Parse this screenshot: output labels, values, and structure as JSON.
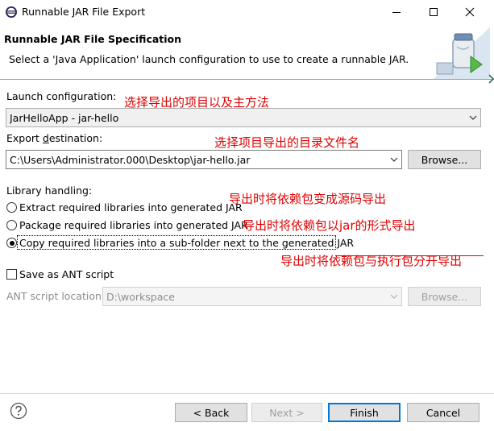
{
  "window": {
    "title": "Runnable JAR File Export",
    "minimize_icon": "minimize-icon",
    "maximize_icon": "maximize-icon",
    "close_icon": "close-icon"
  },
  "header": {
    "title": "Runnable JAR File Specification",
    "description": "Select a 'Java Application' launch configuration to use to create a runnable JAR.",
    "graphic_icon": "jar-export-wizard-icon"
  },
  "launch": {
    "label": "Launch configuration:",
    "value": "JarHelloApp - jar-hello"
  },
  "export": {
    "label": "Export destination:",
    "value": "C:\\Users\\Administrator.000\\Desktop\\jar-hello.jar",
    "browse_label": "Browse..."
  },
  "library": {
    "label": "Library handling:",
    "options": [
      {
        "label": "Extract required libraries into generated JAR",
        "selected": false
      },
      {
        "label": "Package required libraries into generated JAR",
        "selected": false
      },
      {
        "label": "Copy required libraries into a sub-folder next to the generated JAR",
        "selected": true
      }
    ]
  },
  "ant": {
    "save_label": "Save as ANT script",
    "checked": false,
    "location_label": "ANT script location:",
    "location_value": "D:\\workspace",
    "browse_label": "Browse..."
  },
  "annotations": {
    "launch": "选择导出的项目以及主方法",
    "export": "选择项目导出的目录文件名",
    "extract": "导出时将依赖包变成源码导出",
    "package": "导出时将依赖包以jar的形式导出",
    "copy": "导出时将依赖包与执行包分开导出"
  },
  "footer": {
    "help_icon": "help-icon",
    "back_label": "< Back",
    "next_label": "Next >",
    "finish_label": "Finish",
    "cancel_label": "Cancel"
  },
  "colors": {
    "annotation": "#e00000",
    "default_button_border": "#0078d7",
    "disabled_text": "#8d8d8d"
  }
}
